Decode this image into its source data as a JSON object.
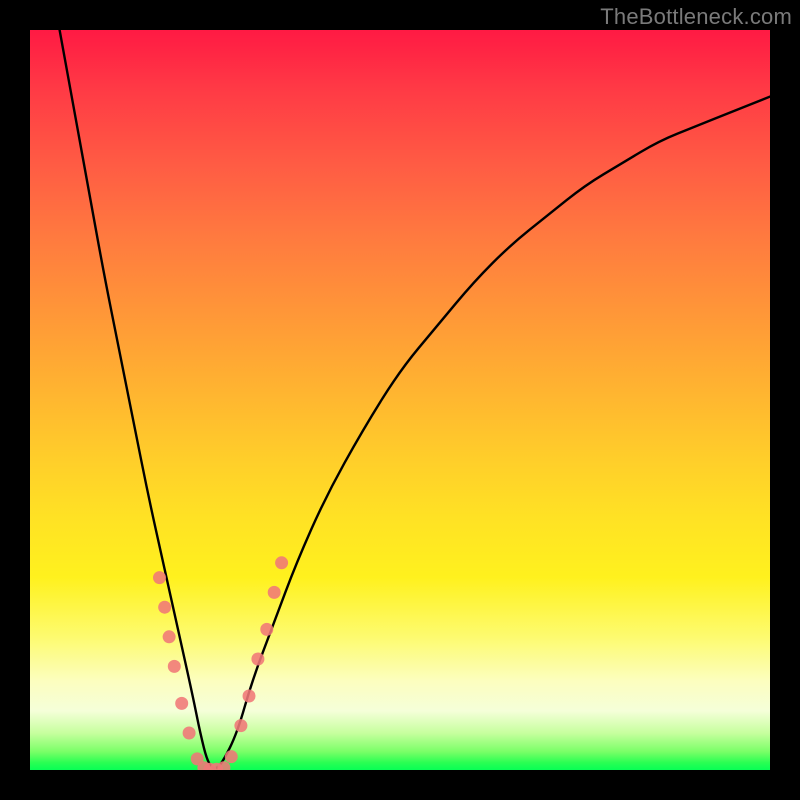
{
  "watermark": "TheBottleneck.com",
  "chart_data": {
    "type": "line",
    "title": "",
    "xlabel": "",
    "ylabel": "",
    "xlim": [
      0,
      100
    ],
    "ylim": [
      0,
      100
    ],
    "grid": false,
    "legend": false,
    "note": "Axes are unlabeled in the image; values below are approximate percentages estimated from the curve shape.",
    "series": [
      {
        "name": "bottleneck-curve",
        "color": "#000000",
        "x": [
          4,
          6,
          8,
          10,
          12,
          14,
          16,
          18,
          20,
          22,
          23,
          24,
          25,
          26,
          28,
          30,
          33,
          36,
          40,
          45,
          50,
          55,
          60,
          65,
          70,
          75,
          80,
          85,
          90,
          95,
          100
        ],
        "values": [
          100,
          89,
          78,
          67,
          57,
          47,
          37,
          28,
          19,
          10,
          5,
          1,
          0,
          1,
          5,
          12,
          20,
          28,
          37,
          46,
          54,
          60,
          66,
          71,
          75,
          79,
          82,
          85,
          87,
          89,
          91
        ]
      }
    ],
    "markers": {
      "note": "Salmon dot markers shown near the valley bottom on both branches and along the floor.",
      "color": "#f07878",
      "points": [
        {
          "x": 17.5,
          "y": 26
        },
        {
          "x": 18.2,
          "y": 22
        },
        {
          "x": 18.8,
          "y": 18
        },
        {
          "x": 19.5,
          "y": 14
        },
        {
          "x": 20.5,
          "y": 9
        },
        {
          "x": 21.5,
          "y": 5
        },
        {
          "x": 22.6,
          "y": 1.5
        },
        {
          "x": 23.5,
          "y": 0.3
        },
        {
          "x": 24.3,
          "y": 0.1
        },
        {
          "x": 25.2,
          "y": 0.1
        },
        {
          "x": 26.2,
          "y": 0.3
        },
        {
          "x": 27.2,
          "y": 1.8
        },
        {
          "x": 28.5,
          "y": 6
        },
        {
          "x": 29.6,
          "y": 10
        },
        {
          "x": 30.8,
          "y": 15
        },
        {
          "x": 32.0,
          "y": 19
        },
        {
          "x": 33.0,
          "y": 24
        },
        {
          "x": 34.0,
          "y": 28
        }
      ]
    },
    "background": {
      "type": "vertical-gradient",
      "stops": [
        {
          "pos": 0.0,
          "color": "#ff1a44"
        },
        {
          "pos": 0.5,
          "color": "#ffc12e"
        },
        {
          "pos": 0.8,
          "color": "#fdfb6f"
        },
        {
          "pos": 0.93,
          "color": "#e8ffc2"
        },
        {
          "pos": 1.0,
          "color": "#08ff55"
        }
      ]
    }
  }
}
